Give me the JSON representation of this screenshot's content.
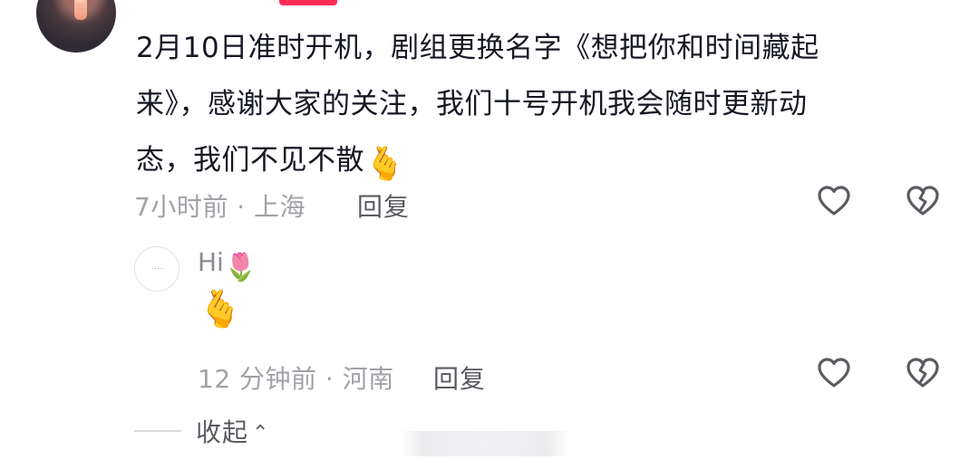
{
  "comment": {
    "username": "",
    "text_line1": "2月10日准时开机，剧组更换名字《想把你和时间藏起",
    "text_line2": "来》，感谢大家的关注，我们十号开机我会随时更新动",
    "text_line3": "态，我们不见不散",
    "emoji": "🫰",
    "meta": "7小时前 · 上海",
    "reply_label": "回复"
  },
  "sub_reply": {
    "username": "Hi",
    "name_emoji": "🌷",
    "content_emoji": "🫰",
    "meta": "12 分钟前 · 河南",
    "reply_label": "回复"
  },
  "collapse_label": "收起",
  "icons": {
    "like": "heart-outline-icon",
    "dislike": "broken-heart-icon",
    "chevron": "chevron-up-icon"
  },
  "colors": {
    "text": "#161823",
    "meta": "#a1a2a7",
    "action": "#5a5b61",
    "badge": "#fe2c55"
  }
}
